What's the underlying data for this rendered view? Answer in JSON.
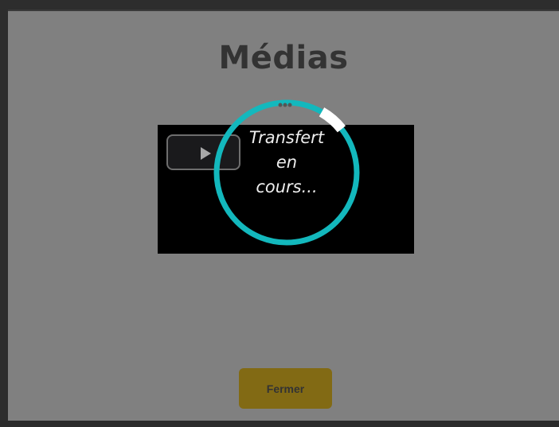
{
  "dialog": {
    "title": "Médias",
    "close_label": "Fermer"
  },
  "upload": {
    "status_lines": [
      "Transfert",
      "en",
      "cours..."
    ],
    "progress": 0.06
  },
  "colors": {
    "overlay": "#808080",
    "video_background": "#000000",
    "spinner_ring": "#13b8bd",
    "spinner_highlight": "#ffffff",
    "close_button": "#826a14"
  },
  "icons": {
    "play": "play-icon"
  }
}
